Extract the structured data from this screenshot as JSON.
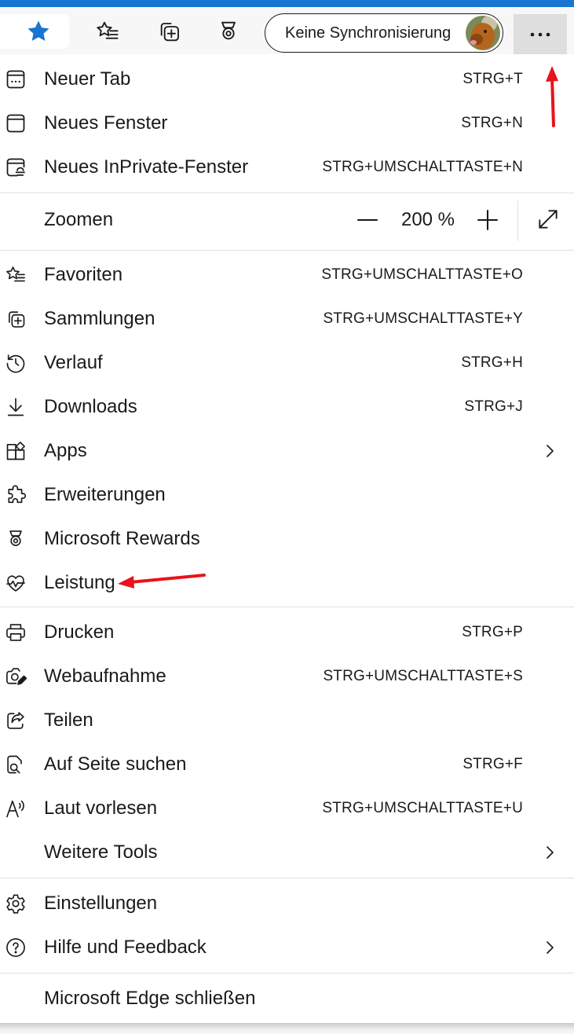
{
  "toolbar": {
    "profile_label": "Keine Synchronisierung",
    "accent_color": "#1875d1",
    "icons": [
      "favorites-star-icon",
      "favorites-list-icon",
      "collections-icon",
      "rewards-icon",
      "avatar",
      "more-dots-icon"
    ]
  },
  "menu": {
    "group1": [
      {
        "label": "Neuer Tab",
        "shortcut": "STRG+T",
        "icon": "new-tab-icon"
      },
      {
        "label": "Neues Fenster",
        "shortcut": "STRG+N",
        "icon": "new-window-icon"
      },
      {
        "label": "Neues InPrivate-Fenster",
        "shortcut": "STRG+UMSCHALTTASTE+N",
        "icon": "inprivate-icon"
      }
    ],
    "zoom": {
      "label": "Zoomen",
      "value": "200 %"
    },
    "group2": [
      {
        "label": "Favoriten",
        "shortcut": "STRG+UMSCHALTTASTE+O",
        "icon": "favorites-icon"
      },
      {
        "label": "Sammlungen",
        "shortcut": "STRG+UMSCHALTTASTE+Y",
        "icon": "collections-icon"
      },
      {
        "label": "Verlauf",
        "shortcut": "STRG+H",
        "icon": "history-icon"
      },
      {
        "label": "Downloads",
        "shortcut": "STRG+J",
        "icon": "download-icon"
      },
      {
        "label": "Apps",
        "shortcut": "",
        "icon": "apps-icon"
      },
      {
        "label": "Erweiterungen",
        "shortcut": "",
        "icon": "extensions-icon"
      },
      {
        "label": "Microsoft Rewards",
        "shortcut": "",
        "icon": "rewards-icon"
      },
      {
        "label": "Leistung",
        "shortcut": "",
        "icon": "performance-icon"
      }
    ],
    "group3": [
      {
        "label": "Drucken",
        "shortcut": "STRG+P",
        "icon": "print-icon"
      },
      {
        "label": "Webaufnahme",
        "shortcut": "STRG+UMSCHALTTASTE+S",
        "icon": "web-capture-icon"
      },
      {
        "label": "Teilen",
        "shortcut": "",
        "icon": "share-icon"
      },
      {
        "label": "Auf Seite suchen",
        "shortcut": "STRG+F",
        "icon": "find-on-page-icon"
      },
      {
        "label": "Laut vorlesen",
        "shortcut": "STRG+UMSCHALTTASTE+U",
        "icon": "read-aloud-icon"
      },
      {
        "label": "Weitere Tools",
        "shortcut": "",
        "icon": ""
      }
    ],
    "group4": [
      {
        "label": "Einstellungen",
        "shortcut": "",
        "icon": "settings-icon"
      },
      {
        "label": "Hilfe und Feedback",
        "shortcut": "",
        "icon": "help-icon"
      }
    ],
    "close": {
      "label": "Microsoft Edge schließen"
    }
  },
  "annotation_color": "#e8141b"
}
